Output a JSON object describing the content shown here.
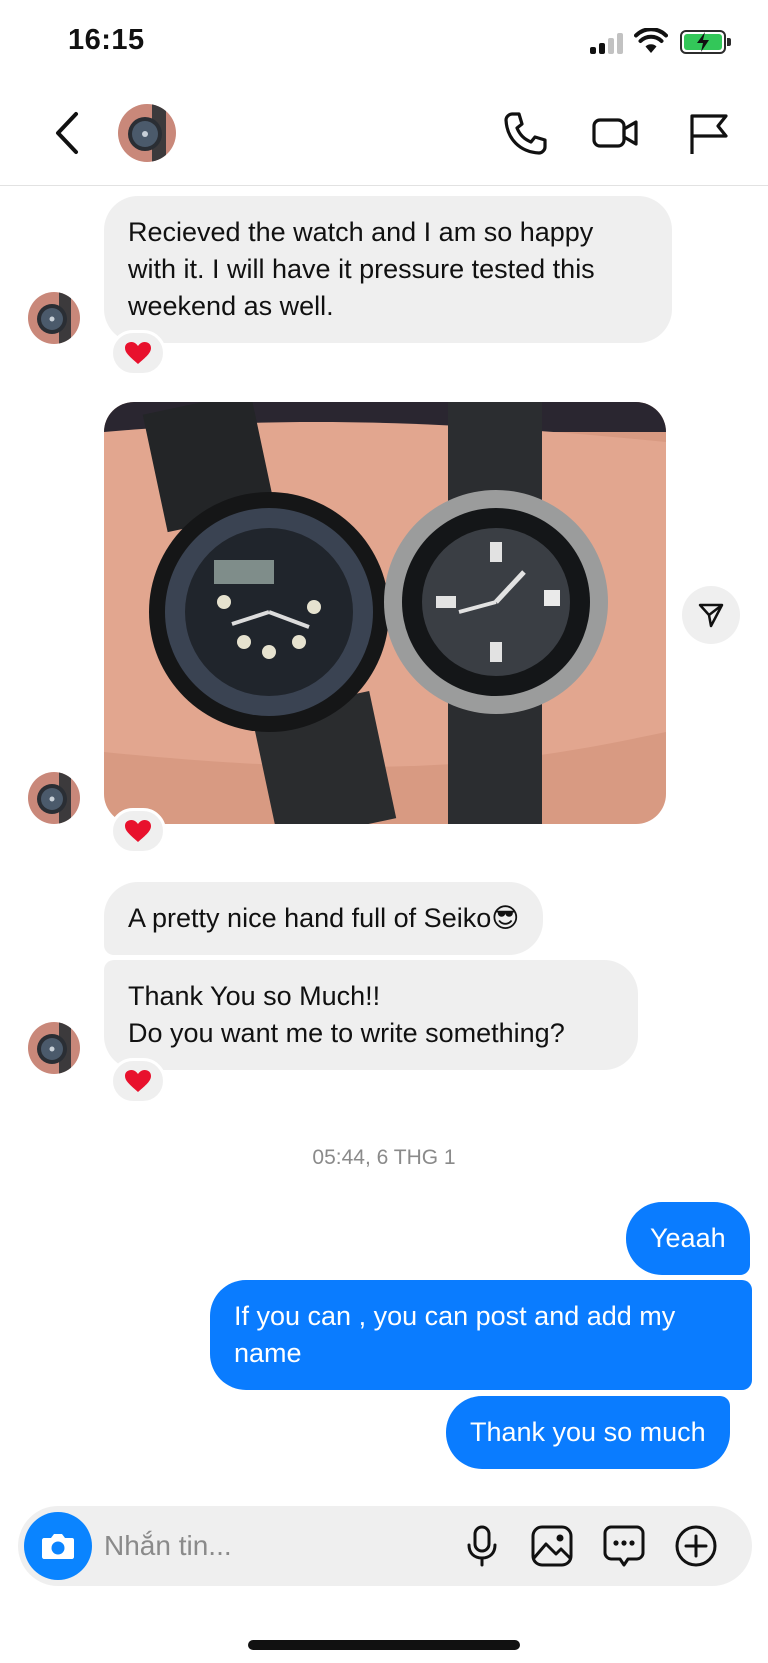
{
  "status_bar": {
    "time": "16:15"
  },
  "conversation": {
    "messages_in": [
      {
        "text": "Recieved the watch and I am so happy with it. I will have it pressure tested this weekend as well.",
        "reaction": "heart"
      },
      {
        "type": "photo",
        "description_icon": "watch-photo",
        "reaction": "heart"
      },
      {
        "text": "A pretty nice hand full of Seiko😎"
      },
      {
        "text": "Thank You so Much!!\nDo you want me to write something?",
        "reaction": "heart"
      }
    ],
    "timestamp": "05:44, 6 THG 1",
    "messages_out": [
      {
        "text": "Yeaah"
      },
      {
        "text": "If you can , you can post and add my name"
      },
      {
        "text": "Thank you so much"
      }
    ]
  },
  "composer": {
    "placeholder": "Nhắn tin..."
  },
  "colors": {
    "outgoing": "#0a7cff",
    "incoming": "#efefef",
    "heart": "#e8112d"
  },
  "icons": [
    "back-chevron-icon",
    "phone-icon",
    "video-icon",
    "flag-icon",
    "share-icon",
    "camera-icon",
    "microphone-icon",
    "gallery-icon",
    "sticker-icon",
    "plus-icon"
  ]
}
